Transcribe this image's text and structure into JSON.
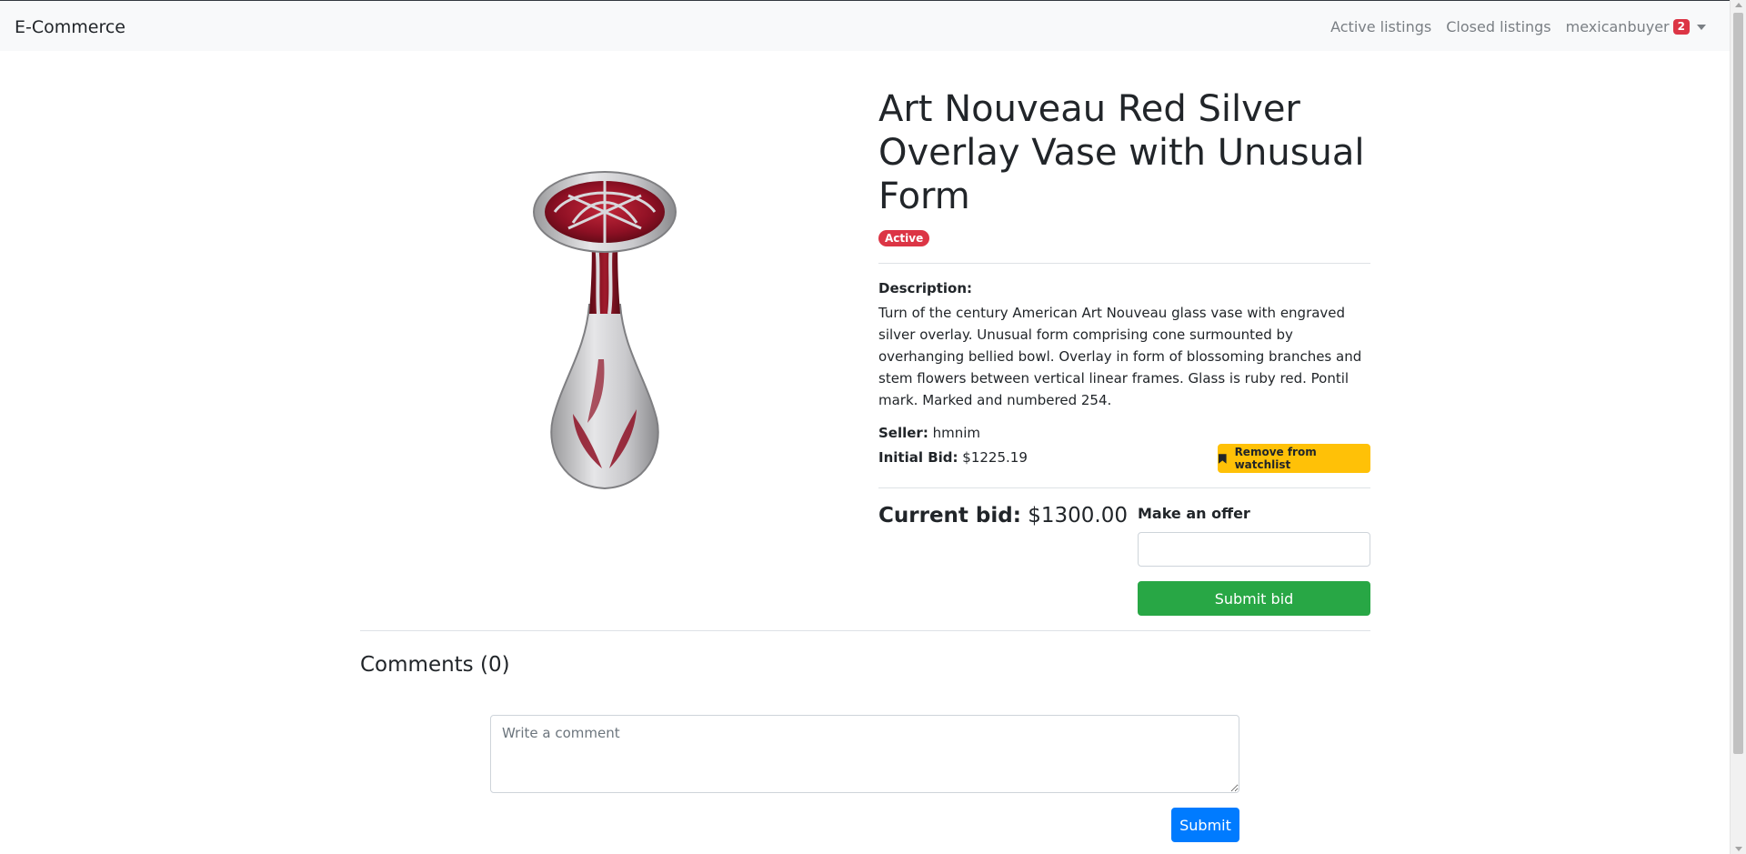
{
  "navbar": {
    "brand": "E-Commerce",
    "links": [
      "Active listings",
      "Closed listings"
    ],
    "username": "mexicanbuyer",
    "watchlist_count": "2"
  },
  "listing": {
    "title": "Art Nouveau Red Silver Overlay Vase with Unusual Form",
    "status": "Active",
    "description_label": "Description:",
    "description": "Turn of the century American Art Nouveau glass vase with engraved silver overlay. Unusual form comprising cone surmounted by overhanging bellied bowl. Overlay in form of blossoming branches and stem flowers between vertical linear frames. Glass is ruby red. Pontil mark. Marked and numbered 254.",
    "seller_label": "Seller:",
    "seller": "hmnim",
    "initial_bid_label": "Initial Bid:",
    "initial_bid": "$1225.19",
    "watchlist_button": "Remove from watchlist",
    "current_bid_label": "Current bid:",
    "current_bid": "$1300.00",
    "offer_label": "Make an offer",
    "submit_bid": "Submit bid"
  },
  "comments": {
    "title": "Comments (0)",
    "placeholder": "Write a comment",
    "submit": "Submit"
  },
  "colors": {
    "danger": "#dc3545",
    "warning": "#ffc107",
    "success": "#28a745",
    "primary": "#007bff"
  }
}
